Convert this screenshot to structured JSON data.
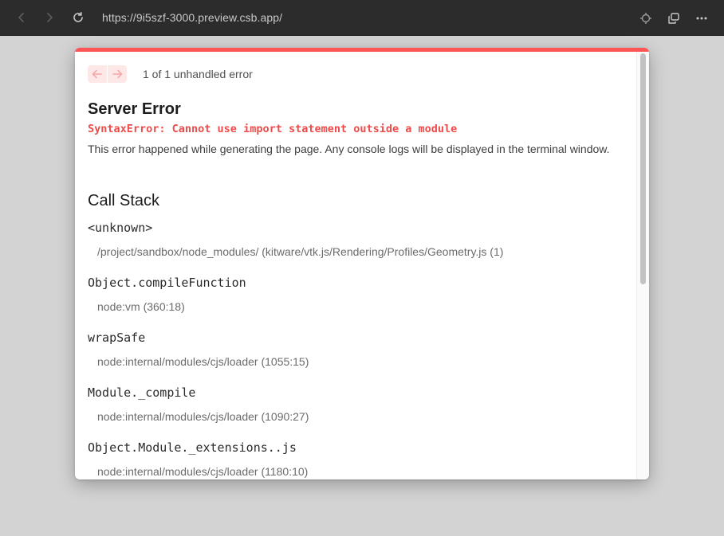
{
  "browser": {
    "url": "https://9i5szf-3000.preview.csb.app/",
    "icons": {
      "back": "chevron-left-icon",
      "forward": "chevron-right-icon",
      "reload": "reload-icon",
      "inspect": "crosshair-icon",
      "open_window": "open-new-window-icon",
      "more": "more-horizontal-icon"
    }
  },
  "overlay": {
    "pager": {
      "count_text": "1 of 1 unhandled error",
      "prev_icon": "arrow-left-icon",
      "next_icon": "arrow-right-icon"
    },
    "title": "Server Error",
    "error_message": "SyntaxError: Cannot use import statement outside a module",
    "description": "This error happened while generating the page. Any console logs will be displayed in the terminal window.",
    "call_stack_title": "Call Stack",
    "frames": [
      {
        "fn": "<unknown>",
        "loc": "/project/sandbox/node_modules/ (kitware/vtk.js/Rendering/Profiles/Geometry.js (1)"
      },
      {
        "fn": "Object.compileFunction",
        "loc": "node:vm (360:18)"
      },
      {
        "fn": "wrapSafe",
        "loc": "node:internal/modules/cjs/loader (1055:15)"
      },
      {
        "fn": "Module._compile",
        "loc": "node:internal/modules/cjs/loader (1090:27)"
      },
      {
        "fn": "Object.Module._extensions..js",
        "loc": "node:internal/modules/cjs/loader (1180:10)"
      }
    ]
  },
  "colors": {
    "accent": "#ff5555",
    "error_text": "#ee4b4b",
    "chrome_bg": "#2c2c2c",
    "page_bg": "#d3d3d3"
  }
}
